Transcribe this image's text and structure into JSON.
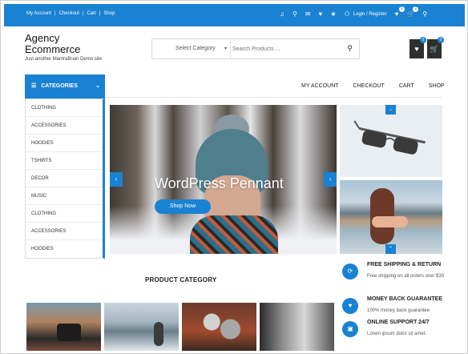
{
  "topbar": {
    "links": [
      "My Account",
      "|",
      "Checkout",
      "|",
      "Cart",
      "|",
      "Shop"
    ],
    "login_label": "Login / Register",
    "wishlist_count": "0",
    "cart_count": "2"
  },
  "header": {
    "site_title": "Agency Ecommerce",
    "tagline": "Just another MantraBrain Demo site",
    "search": {
      "category_label": "Select Category",
      "placeholder": "Search Products ..."
    },
    "wishlist_badge": "0",
    "cart_badge": "0"
  },
  "nav": {
    "categories_label": "CATEGORIES",
    "menu": [
      "MY ACCOUNT",
      "CHECKOUT",
      "CART",
      "SHOP"
    ]
  },
  "categories": [
    "CLOTHING",
    "ACCESSORIES",
    "HOODIES",
    "TSHIRTS",
    "DECOR",
    "MUSIC",
    "CLOTHING",
    "ACCESSORIES",
    "HOODIES"
  ],
  "slider": {
    "title": "WordPress Pennant",
    "button": "Shop Now"
  },
  "section": {
    "product_category_title": "PRODUCT CATEGORY"
  },
  "features": [
    {
      "icon": "refresh-icon",
      "title": "FREE SHIPPING & RETURN",
      "desc": "Free shipping on all orders over $39"
    },
    {
      "icon": "heart-icon",
      "title": "MONEY BACK GUARANTEE",
      "desc": "100% money back guarantee"
    },
    {
      "icon": "support-icon",
      "title": "ONLINE SUPPORT 24/7",
      "desc": "Lorem ipsum dolor sit amet."
    }
  ],
  "colors": {
    "accent": "#1a82d2"
  }
}
